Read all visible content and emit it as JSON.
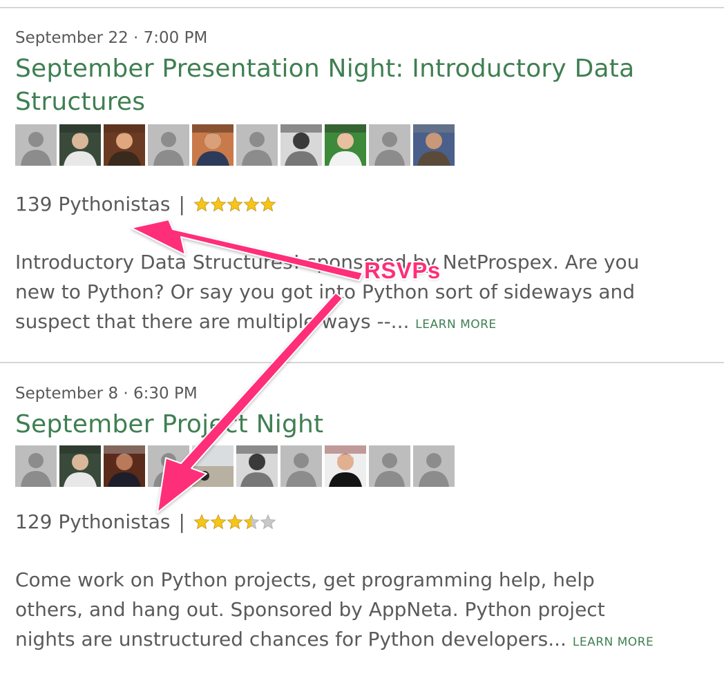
{
  "events": [
    {
      "date": "September 22 · 7:00 PM",
      "title_line1": "September Presentation Night: Introductory Data",
      "title_line2": "Structures",
      "attendees": [
        {
          "type": "placeholder"
        },
        {
          "type": "photo-dark-desk"
        },
        {
          "type": "photo-bearded-smile"
        },
        {
          "type": "placeholder"
        },
        {
          "type": "photo-curly-hair"
        },
        {
          "type": "placeholder"
        },
        {
          "type": "photo-bw-family"
        },
        {
          "type": "photo-green-bg-man"
        },
        {
          "type": "placeholder"
        },
        {
          "type": "photo-grey-beard-man"
        }
      ],
      "rsvp_count_text": "139 Pythonistas",
      "separator": "|",
      "rating": 5,
      "rating_max": 5,
      "desc_line1": "Introductory Data Structures! sponsored by NetProspex. Are you",
      "desc_line2": "new to Python? Or say you got into Python sort of sideways and",
      "desc_line3": "suspect that there are multiple ways --...",
      "learn_more": "LEARN MORE"
    },
    {
      "date": "September 8 · 6:30 PM",
      "title_line1": "September Project Night",
      "attendees": [
        {
          "type": "placeholder"
        },
        {
          "type": "photo-dark-desk"
        },
        {
          "type": "photo-suit-man"
        },
        {
          "type": "placeholder"
        },
        {
          "type": "photo-beach"
        },
        {
          "type": "photo-bw-family"
        },
        {
          "type": "placeholder"
        },
        {
          "type": "photo-dark-suit-man"
        },
        {
          "type": "placeholder"
        },
        {
          "type": "placeholder"
        }
      ],
      "rsvp_count_text": "129 Pythonistas",
      "separator": "|",
      "rating": 3.5,
      "rating_max": 5,
      "desc_line1": "Come work on Python projects, get programming help, help",
      "desc_line2": "others, and hang out. Sponsored by AppNeta. Python project",
      "desc_line3": "nights are unstructured chances for Python developers...",
      "learn_more": "LEARN MORE"
    }
  ],
  "annotation": {
    "label": "RSVPs",
    "color": "#ff2e78"
  },
  "colors": {
    "title_green": "#3f7f52",
    "star_gold": "#f5c518",
    "star_grey": "#c8c8c8"
  }
}
